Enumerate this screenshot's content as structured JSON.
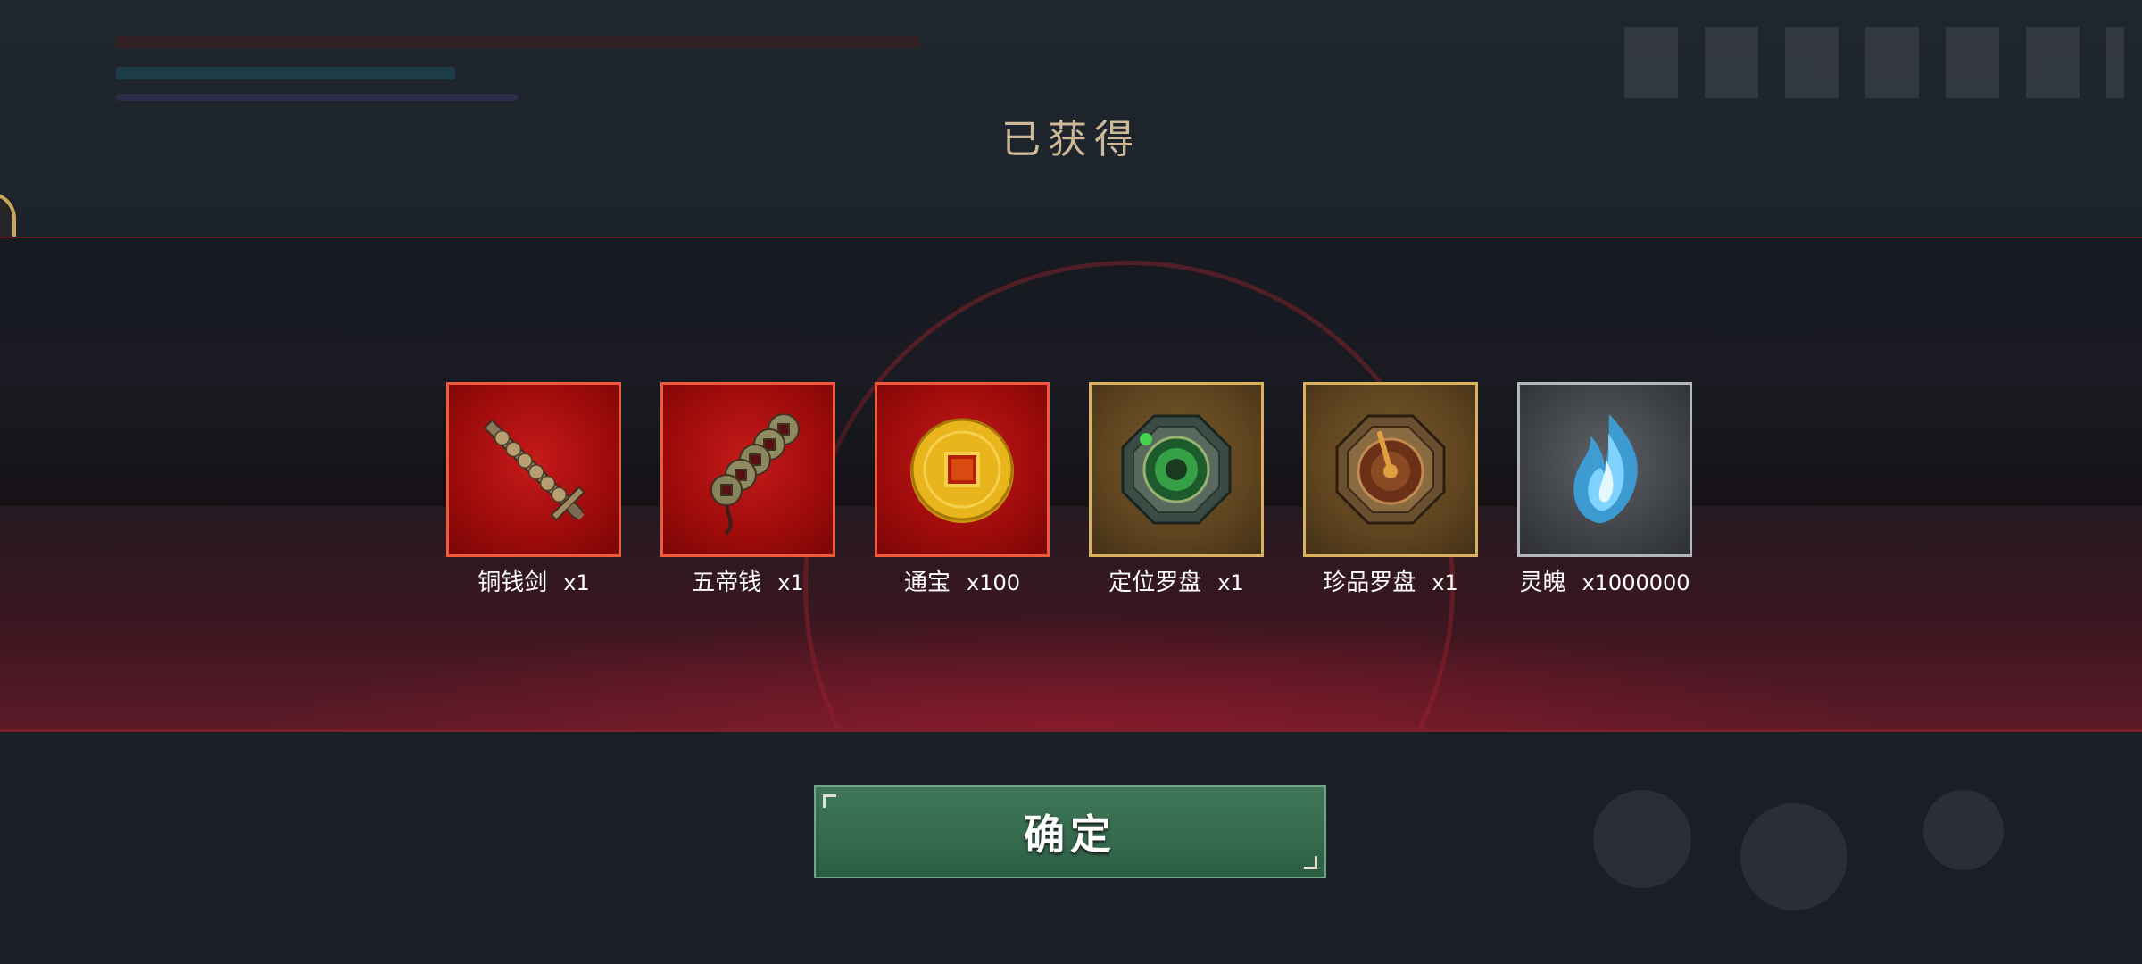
{
  "dialog": {
    "title": "已获得",
    "confirm_label": "确定"
  },
  "rewards": [
    {
      "name": "铜钱剑",
      "qty": "x1",
      "rarity": "red",
      "icon": "copper-coin-sword-icon"
    },
    {
      "name": "五帝钱",
      "qty": "x1",
      "rarity": "red",
      "icon": "five-emperor-coins-icon"
    },
    {
      "name": "通宝",
      "qty": "x100",
      "rarity": "red",
      "icon": "gold-coin-icon"
    },
    {
      "name": "定位罗盘",
      "qty": "x1",
      "rarity": "gold",
      "icon": "jade-compass-icon"
    },
    {
      "name": "珍品罗盘",
      "qty": "x1",
      "rarity": "gold",
      "icon": "bronze-compass-icon"
    },
    {
      "name": "灵魄",
      "qty": "x1000000",
      "rarity": "grey",
      "icon": "blue-spirit-flame-icon"
    }
  ],
  "colors": {
    "rarity_red": "#f05a3a",
    "rarity_gold": "#d7b15e",
    "rarity_grey": "#b3b7bd",
    "confirm_green": "#3f7657",
    "title_text": "#cdb99a"
  }
}
